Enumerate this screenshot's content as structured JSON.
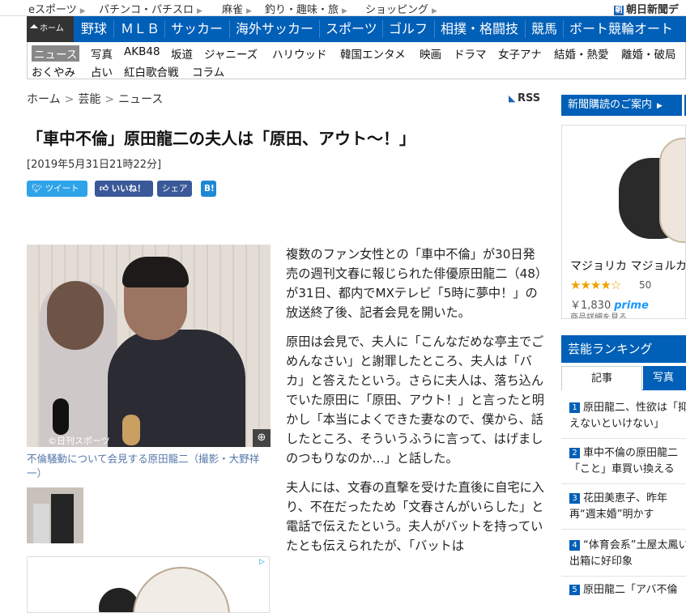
{
  "topbar": {
    "items": [
      "eスポーツ",
      "パチンコ・パチスロ",
      "麻雀",
      "釣り・趣味・旅",
      "ショッピング"
    ],
    "asahi": "朝日新聞デ"
  },
  "nav_main": {
    "home": "ホーム",
    "items": [
      "野球",
      "ＭＬＢ",
      "サッカー",
      "海外サッカー",
      "スポーツ",
      "ゴルフ",
      "相撲・格闘技",
      "競馬",
      "ボート競輪オート"
    ]
  },
  "nav_sub": {
    "row1": [
      "ニュース",
      "写真",
      "AKB48",
      "坂道",
      "ジャニーズ",
      "ハリウッド",
      "韓国エンタメ",
      "映画",
      "ドラマ",
      "女子アナ",
      "結婚・熱愛",
      "離婚・破局"
    ],
    "row2": [
      "おくやみ",
      "占い",
      "紅白歌合戦",
      "コラム"
    ]
  },
  "breadcrumb": {
    "home": "ホーム",
    "cat": "芸能",
    "page": "ニュース",
    "sep": ">"
  },
  "rss": "RSS",
  "article": {
    "title": "「車中不倫」原田龍二の夫人は「原田、アウト～！」",
    "date": "[2019年5月31日21時22分]",
    "share": {
      "tweet": "ツイート",
      "like": "いいね！",
      "share": "シェア",
      "hatena": "B!"
    },
    "photo_credit": "©日刊スポーツ",
    "caption": "不倫騒動について会見する原田龍二（撮影・大野祥一）",
    "paragraphs": [
      "複数のファン女性との「車中不倫」が30日発売の週刊文春に報じられた俳優原田龍二（48）が31日、都内でMXテレビ「5時に夢中！」の放送終了後、記者会見を開いた。",
      "原田は会見で、夫人に「こんなだめな亭主でごめんなさい」と謝罪したところ、夫人は「バカ」と答えたという。さらに夫人は、落ち込んでいた原田に「原田、アウト！」と言ったと明かし「本当によくできた妻なので、僕から、話したところ、そういうふうに言って、はげましのつもりなのか…」と話した。",
      "夫人には、文春の直撃を受けた直後に自宅に入り、不在だったため「文春さんがいらした」と電話で伝えたという。夫人がバットを持っていたとも伝えられたが、「バットは"
    ]
  },
  "sidebar": {
    "subscribe": "新聞購読のご案内",
    "ad": {
      "product": "マジョリカ マジョルカ",
      "stars": "★★★★☆",
      "count": "50",
      "price": "￥1,830",
      "prime": "prime",
      "detail": "商品詳細を見る"
    },
    "ranking_title": "芸能ランキング",
    "tabs": [
      "記事",
      "写真"
    ],
    "ranking": [
      {
        "num": "1",
        "text": "原田龍二、性欲は「抑えないといけない」"
      },
      {
        "num": "2",
        "text": "車中不倫の原田龍二「こと」車買い換える"
      },
      {
        "num": "3",
        "text": "花田美恵子、昨年再“週末婚”明かす"
      },
      {
        "num": "4",
        "text": "“体育会系”土屋太鳳い出箱に好印象"
      },
      {
        "num": "5",
        "text": "原田龍二「アバ不倫"
      }
    ]
  }
}
